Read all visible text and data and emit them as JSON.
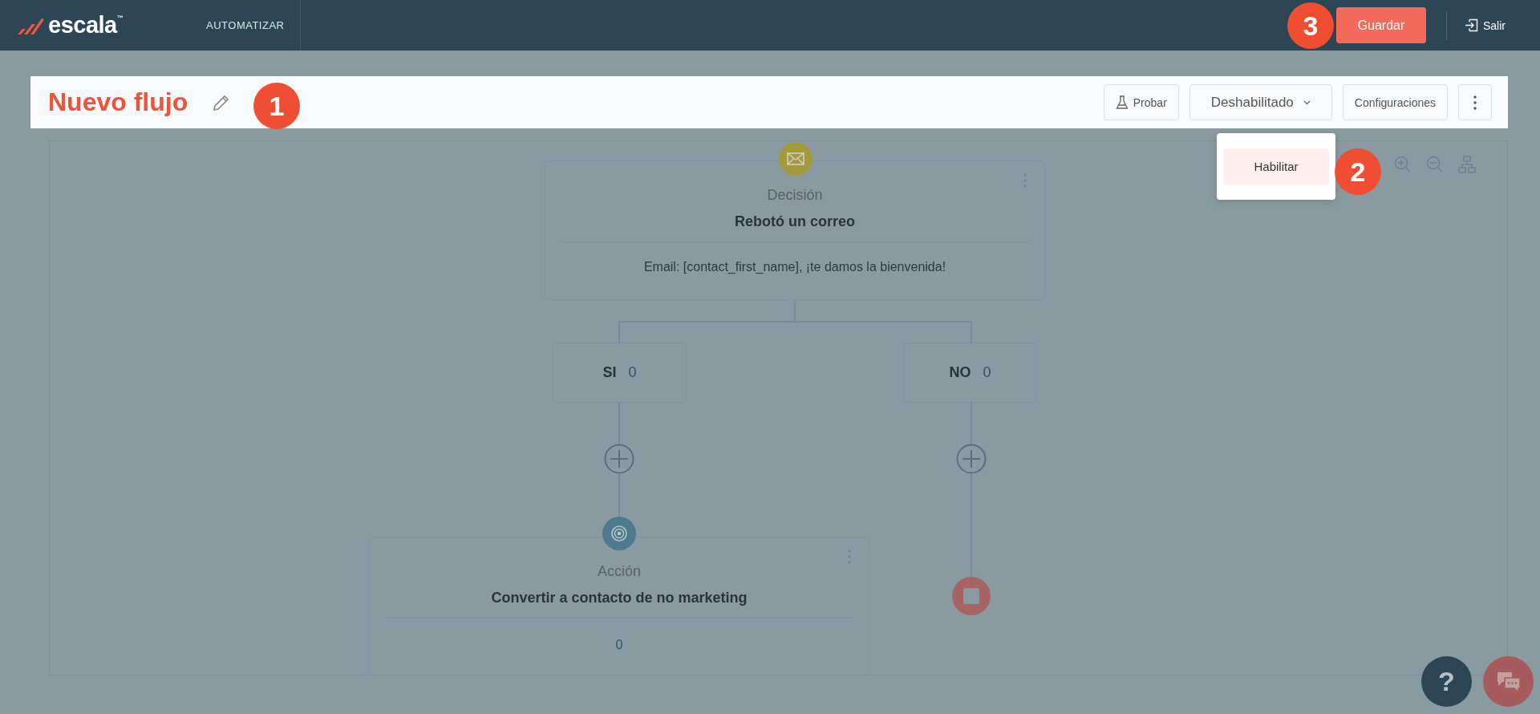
{
  "header": {
    "logo": "escala$^{™}$",
    "nav": "AUTOMATIZAR",
    "save": "Guardar",
    "exit": "Salir"
  },
  "flow": {
    "title": "Nuevo flujo"
  },
  "toolbar": {
    "test": "Probar",
    "status": "Deshabilitado",
    "settings": "Configuraciones"
  },
  "status_menu": {
    "items": [
      {
        "label": "Habilitar",
        "selected": true
      }
    ]
  },
  "callouts": [
    {
      "number": "1"
    },
    {
      "number": "2"
    },
    {
      "number": "3"
    }
  ],
  "decision": {
    "type": "Decisión",
    "title": "Rebotó un correo",
    "detail": "Email: [contact_first_name], ¡te damos la bienvenida!"
  },
  "branches": [
    {
      "label": "SI",
      "count": "0"
    },
    {
      "label": "NO",
      "count": "0"
    }
  ],
  "action": {
    "type": "Acción",
    "title": "Convertir a contacto de no marketing",
    "count": "0"
  },
  "help": "?"
}
